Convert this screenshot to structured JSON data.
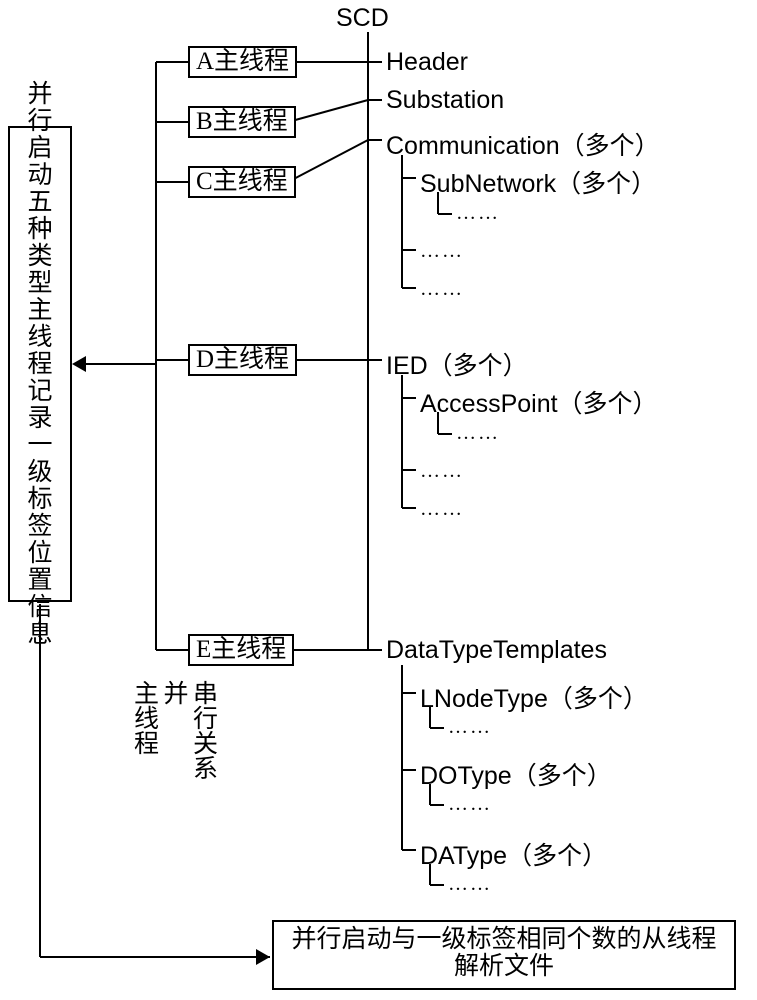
{
  "root_label": "SCD",
  "left_box": "并行启动五种类型主线程记录一级标签位置信息",
  "threads": {
    "a": "A主线程",
    "b": "B主线程",
    "c": "C主线程",
    "d": "D主线程",
    "e": "E主线程"
  },
  "nodes": {
    "header": "Header",
    "substation": "Substation",
    "communication": "Communication（多个）",
    "subnetwork": "SubNetwork（多个）",
    "ied": "IED（多个）",
    "accesspoint": "AccessPoint（多个）",
    "datatype": "DataTypeTemplates",
    "lnodetype": "LNodeType（多个）",
    "dotype": "DOType（多个）",
    "datype": "DAType（多个）"
  },
  "ellipsis": "……",
  "mid_vtext_col1": "主线程",
  "mid_vtext_col2": "并",
  "mid_vtext_col3": "串行关系",
  "bottom_box": "并行启动与一级标签相同个数的从线程解析文件"
}
